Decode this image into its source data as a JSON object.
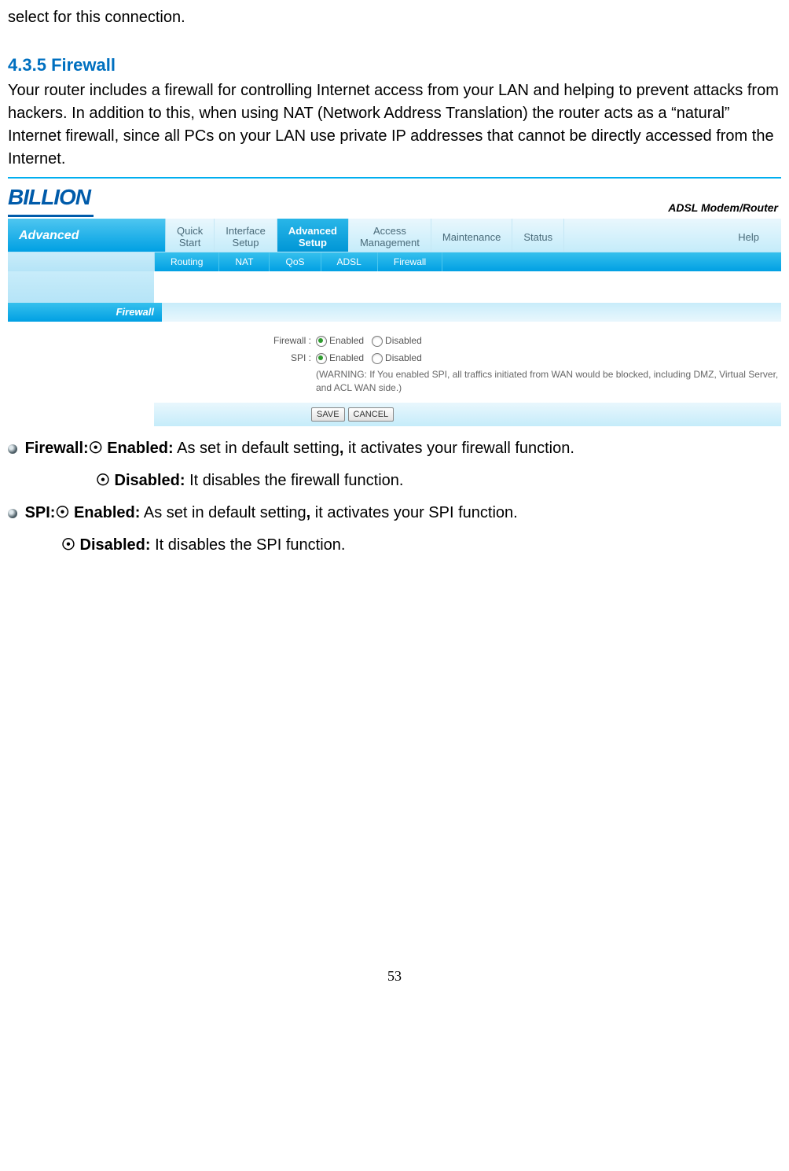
{
  "intro_fragment": "select for this connection.",
  "section": {
    "number": "4.3.5",
    "title": "Firewall",
    "body": "Your router includes a firewall for controlling Internet access from your LAN and helping to prevent attacks from hackers. In addition to this, when using NAT (Network Address Translation) the router acts as a “natural” Internet firewall, since all PCs on your LAN use private IP addresses that cannot be directly accessed from the Internet."
  },
  "screenshot": {
    "logo": "BILLION",
    "product": "ADSL Modem/Router",
    "nav_left": "Advanced",
    "nav": [
      {
        "l1": "Quick",
        "l2": "Start"
      },
      {
        "l1": "Interface",
        "l2": "Setup"
      },
      {
        "l1": "Advanced",
        "l2": "Setup"
      },
      {
        "l1": "Access",
        "l2": "Management"
      },
      {
        "l1": "Maintenance",
        "l2": ""
      },
      {
        "l1": "Status",
        "l2": ""
      },
      {
        "l1": "Help",
        "l2": ""
      }
    ],
    "subnav": [
      "Routing",
      "NAT",
      "QoS",
      "ADSL",
      "Firewall"
    ],
    "section_label": "Firewall",
    "form": {
      "firewall_label": "Firewall :",
      "spi_label": "SPI :",
      "enabled": "Enabled",
      "disabled": "Disabled",
      "warning": "(WARNING: If You enabled SPI, all traffics initiated from WAN would be blocked, including DMZ, Virtual Server, and ACL WAN side.)"
    },
    "buttons": {
      "save": "SAVE",
      "cancel": "CANCEL"
    }
  },
  "desc": {
    "firewall_label": "Firewall:",
    "spi_label": "SPI:",
    "enabled_label": "Enabled:",
    "disabled_label": "Disabled:",
    "fw_enabled_text": " As set in default setting",
    "fw_enabled_tail": " it activates your firewall function.",
    "fw_disabled_text": " It disables the firewall function.",
    "spi_enabled_text": " As set in default setting",
    "spi_enabled_tail": " it activates your SPI function.",
    "spi_disabled_text": " It disables the SPI function.",
    "comma": ","
  },
  "page_number": "53"
}
